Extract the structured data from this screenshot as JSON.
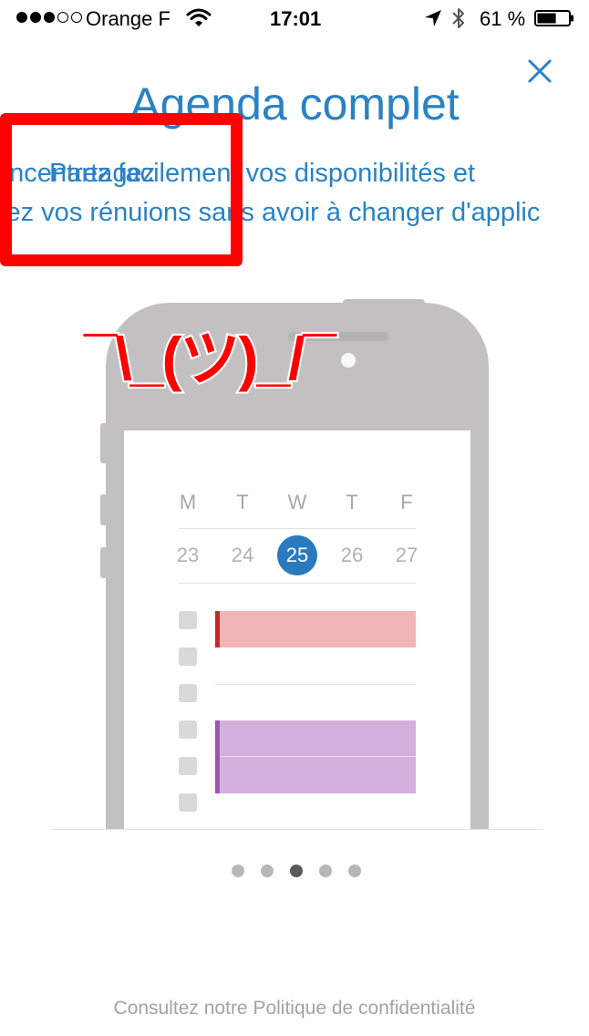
{
  "status_bar": {
    "carrier": "Orange F",
    "time": "17:01",
    "battery_percent": "61 %",
    "signal_bars_filled": 3,
    "signal_bars_total": 5,
    "battery_level": 0.61,
    "icons": [
      "signal-dots-icon",
      "wifi-icon",
      "location-arrow-icon",
      "bluetooth-icon",
      "battery-icon"
    ]
  },
  "header": {
    "title": "Agenda complet",
    "close_icon": "close-icon",
    "description_line_1": "oncentrez facilement vos disponibilités et",
    "description_line_2": "fiez vos rénuions sans avoir à changer d'applic",
    "description_overlay": "Partagez"
  },
  "meme": {
    "text": "¯\\_(ツ)_/¯"
  },
  "calendar": {
    "weekdays": [
      "M",
      "T",
      "W",
      "T",
      "F"
    ],
    "days": [
      "23",
      "24",
      "25",
      "26",
      "27"
    ],
    "selected_day": "25"
  },
  "pager": {
    "total": 5,
    "active_index": 2
  },
  "footer": {
    "privacy_link": "Consultez notre Politique de confidentialité"
  },
  "colors": {
    "accent": "#2a82c4",
    "selected_day": "#2a7bbd",
    "event_red": "#f0b6b5",
    "event_red_border": "#c6272a",
    "event_purple": "#d3afdc",
    "event_purple_border": "#9b55ad",
    "annotation_red": "#ff0000"
  }
}
